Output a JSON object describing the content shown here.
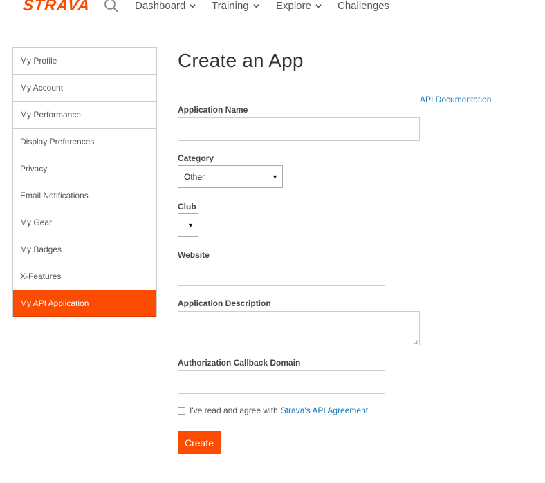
{
  "brand": {
    "logo": "STRAVA",
    "color": "#fc4c02"
  },
  "topnav": {
    "search_icon": "search-icon",
    "items": [
      {
        "label": "Dashboard",
        "has_dropdown": true
      },
      {
        "label": "Training",
        "has_dropdown": true
      },
      {
        "label": "Explore",
        "has_dropdown": true
      },
      {
        "label": "Challenges",
        "has_dropdown": false
      }
    ]
  },
  "sidebar": {
    "items": [
      {
        "label": "My Profile",
        "active": false
      },
      {
        "label": "My Account",
        "active": false
      },
      {
        "label": "My Performance",
        "active": false
      },
      {
        "label": "Display Preferences",
        "active": false
      },
      {
        "label": "Privacy",
        "active": false
      },
      {
        "label": "Email Notifications",
        "active": false
      },
      {
        "label": "My Gear",
        "active": false
      },
      {
        "label": "My Badges",
        "active": false
      },
      {
        "label": "X-Features",
        "active": false
      },
      {
        "label": "My API Application",
        "active": true
      }
    ]
  },
  "main": {
    "title": "Create an App",
    "api_documentation_link": "API Documentation",
    "form": {
      "application_name": {
        "label": "Application Name",
        "value": ""
      },
      "category": {
        "label": "Category",
        "selected": "Other"
      },
      "club": {
        "label": "Club",
        "selected": ""
      },
      "website": {
        "label": "Website",
        "value": ""
      },
      "application_description": {
        "label": "Application Description",
        "value": ""
      },
      "callback_domain": {
        "label": "Authorization Callback Domain",
        "value": ""
      },
      "agreement": {
        "text": "I've read and agree with",
        "link_text": "Strava's API Agreement",
        "checked": false
      },
      "submit_label": "Create"
    }
  }
}
